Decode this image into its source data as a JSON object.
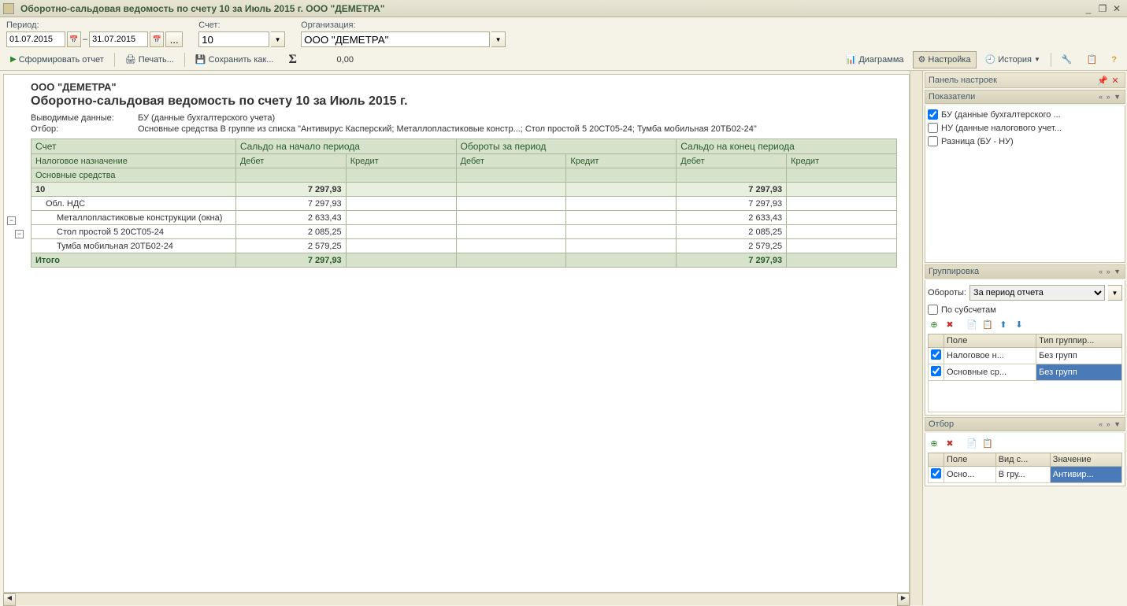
{
  "window": {
    "title": "Оборотно-сальдовая ведомость по счету 10 за Июль 2015 г. ООО \"ДЕМЕТРА\""
  },
  "params": {
    "period_label": "Период:",
    "date_from": "01.07.2015",
    "date_to": "31.07.2015",
    "account_label": "Счет:",
    "account": "10",
    "org_label": "Организация:",
    "org": "ООО \"ДЕМЕТРА\""
  },
  "toolbar": {
    "form_report": "Сформировать отчет",
    "print": "Печать...",
    "save_as": "Сохранить как...",
    "sigma_value": "0,00",
    "diagram": "Диаграмма",
    "settings": "Настройка",
    "history": "История"
  },
  "report": {
    "org_name": "ООО \"ДЕМЕТРА\"",
    "title": "Оборотно-сальдовая ведомость по счету 10 за Июль 2015 г.",
    "output_label": "Выводимые данные:",
    "output_value": "БУ (данные бухгалтерского учета)",
    "filter_label": "Отбор:",
    "filter_value": "Основные средства В группе из списка \"Антивирус Касперский; Металлопластиковые констр...; Стол простой 5 20СТ05-24; Тумба мобильная 20ТБ02-24\"",
    "headers": {
      "account": "Счет",
      "balance_start": "Сальдо на начало периода",
      "turnover": "Обороты за период",
      "balance_end": "Сальдо на конец периода",
      "tax": "Налоговое назначение",
      "debit": "Дебет",
      "credit": "Кредит",
      "assets": "Основные средства"
    },
    "rows": [
      {
        "label": "10",
        "d1": "7 297,93",
        "c1": "",
        "d2": "",
        "c2": "",
        "d3": "7 297,93",
        "c3": "",
        "bold": true
      },
      {
        "label": "Обл. НДС",
        "d1": "7 297,93",
        "c1": "",
        "d2": "",
        "c2": "",
        "d3": "7 297,93",
        "c3": "",
        "indent": 1
      },
      {
        "label": "Металлопластиковые конструкции (окна)",
        "d1": "2 633,43",
        "c1": "",
        "d2": "",
        "c2": "",
        "d3": "2 633,43",
        "c3": "",
        "indent": 2
      },
      {
        "label": "Стол простой 5 20СТ05-24",
        "d1": "2 085,25",
        "c1": "",
        "d2": "",
        "c2": "",
        "d3": "2 085,25",
        "c3": "",
        "indent": 2
      },
      {
        "label": "Тумба мобильная 20ТБ02-24",
        "d1": "2 579,25",
        "c1": "",
        "d2": "",
        "c2": "",
        "d3": "2 579,25",
        "c3": "",
        "indent": 2
      }
    ],
    "total": {
      "label": "Итого",
      "d1": "7 297,93",
      "c1": "",
      "d2": "",
      "c2": "",
      "d3": "7 297,93",
      "c3": ""
    }
  },
  "right": {
    "panel_title": "Панель настроек",
    "indicators": {
      "title": "Показатели",
      "items": [
        {
          "checked": true,
          "label": "БУ (данные бухгалтерского ..."
        },
        {
          "checked": false,
          "label": "НУ (данные налогового учет..."
        },
        {
          "checked": false,
          "label": "Разница (БУ - НУ)"
        }
      ]
    },
    "grouping": {
      "title": "Группировка",
      "turns_label": "Обороты:",
      "turns_value": "За период отчета",
      "by_sub": "По субсчетам",
      "col_field": "Поле",
      "col_type": "Тип группир...",
      "rows": [
        {
          "checked": true,
          "field": "Налоговое н...",
          "type": "Без групп",
          "sel": false
        },
        {
          "checked": true,
          "field": "Основные ср...",
          "type": "Без групп",
          "sel": true
        }
      ]
    },
    "filter": {
      "title": "Отбор",
      "col_field": "Поле",
      "col_cmp": "Вид с...",
      "col_val": "Значение",
      "rows": [
        {
          "checked": true,
          "field": "Осно...",
          "cmp": "В гру...",
          "val": "Антивир...",
          "sel": true
        }
      ]
    }
  }
}
